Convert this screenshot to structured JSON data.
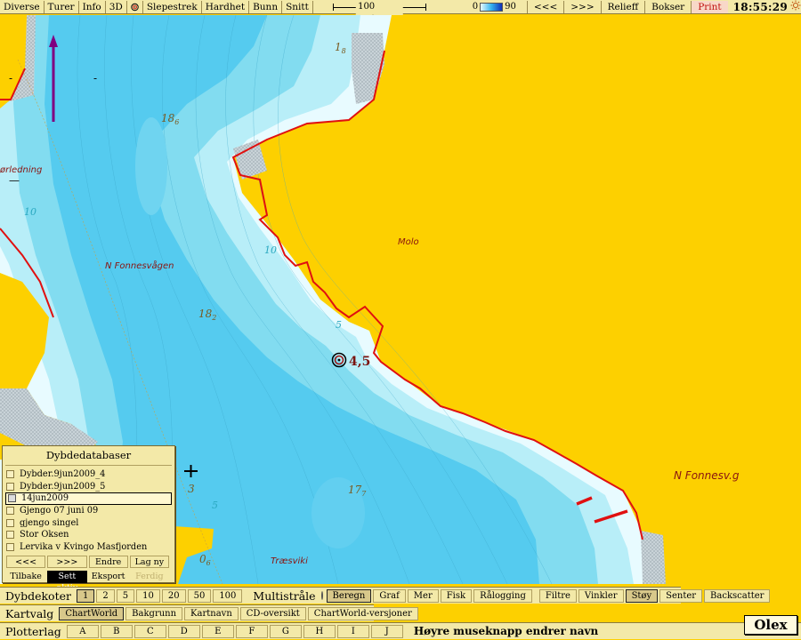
{
  "topbar": {
    "menu": [
      "Diverse",
      "Turer",
      "Info",
      "3D"
    ],
    "menu2": [
      "Slepestrek",
      "Hardhet",
      "Bunn",
      "Snitt"
    ],
    "scale_label": "100 meter",
    "depth_min": "0",
    "depth_max": "90",
    "right_buttons": [
      "<<<",
      ">>>",
      "Relieff",
      "Bokser"
    ],
    "print_label": "Print",
    "clock": "18:55:29"
  },
  "map": {
    "labels": {
      "molo": "Molo",
      "n_fonnesvagen": "N Fonnesvågen",
      "n_fonnesv_g": "N Fonnesv.g",
      "traesviki": "Træsviki",
      "orledning": "ørledning"
    },
    "depths": {
      "d18_top": "18",
      "d18_top_sub": "6",
      "d1_8_main": "1",
      "d1_8_sub": "8",
      "d18_mid": "18",
      "d18_mid_sub": "2",
      "d17": "17",
      "d17_sub": "7",
      "d0_6": "0",
      "d0_6_sub": "6",
      "d3": "3",
      "blue_10a": "10",
      "blue_10b": "10",
      "blue_5a": "5",
      "blue_5b": "5"
    },
    "marker_value": "4,5"
  },
  "depth_db": {
    "title": "Dybdedatabaser",
    "items": [
      {
        "label": "Dybder.9jun2009_4",
        "selected": false
      },
      {
        "label": "Dybder.9jun2009_5",
        "selected": false
      },
      {
        "label": "14jun2009",
        "selected": true
      },
      {
        "label": "Gjengo 07 juni 09",
        "selected": false
      },
      {
        "label": "gjengo singel",
        "selected": false
      },
      {
        "label": "Stor Oksen",
        "selected": false
      },
      {
        "label": "Lervika v Kvingo Masfjorden",
        "selected": false
      }
    ],
    "nav": [
      "<<<",
      ">>>",
      "Endre",
      "Lag ny"
    ],
    "actions": [
      "Tilbake",
      "Sett aktiv",
      "Eksport",
      "Ferdig"
    ]
  },
  "bottom": {
    "dybdekoter_label": "Dybdekoter",
    "dybdekoter_values": [
      "1",
      "2",
      "5",
      "10",
      "20",
      "50",
      "100"
    ],
    "multistraale_label": "Multistråle",
    "multi_buttons": [
      "Beregn",
      "Graf",
      "Mer",
      "Fisk",
      "Rålogging"
    ],
    "filter_buttons": [
      "Filtre",
      "Vinkler",
      "Støy",
      "Senter",
      "Backscatter"
    ],
    "kartvalg_label": "Kartvalg",
    "kartvalg_buttons": [
      "ChartWorld",
      "Bakgrunn",
      "Kartnavn",
      "CD-oversikt",
      "ChartWorld-versjoner"
    ],
    "plotterlag_label": "Plotterlag",
    "plotterlag_buttons": [
      "A",
      "B",
      "C",
      "D",
      "E",
      "F",
      "G",
      "H",
      "I",
      "J"
    ],
    "hint": "Høyre museknapp endrer navn",
    "brand": "Olex"
  },
  "colors": {
    "land": "#fdd000",
    "shallow": "#e8fbff",
    "water_mid": "#7fdcf0",
    "water_deep": "#46c8ec",
    "coastline": "#e01010",
    "panel": "#f3e9a8"
  }
}
